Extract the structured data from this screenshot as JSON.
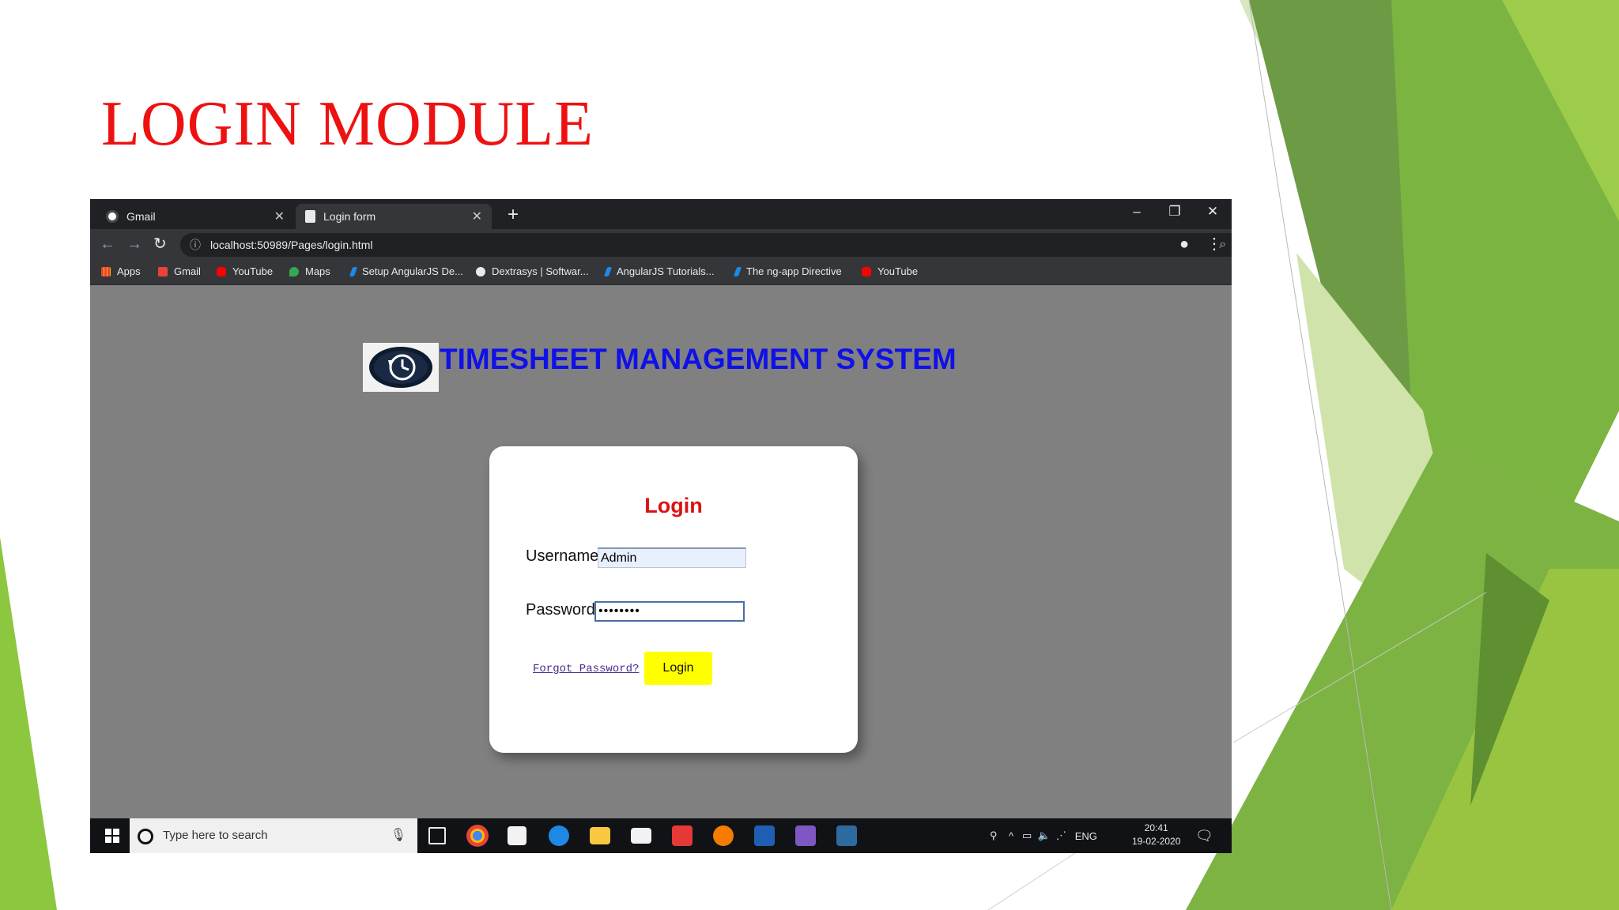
{
  "slide": {
    "title": "LOGIN MODULE"
  },
  "browser": {
    "tabs": [
      {
        "label": "Gmail",
        "icon": "google-icon",
        "active": false
      },
      {
        "label": "Login form",
        "icon": "page-icon",
        "active": true
      }
    ],
    "new_tab": "+",
    "window_controls": {
      "minimize": "–",
      "restore": "❐",
      "close": "✕"
    },
    "url": "localhost:50989/Pages/login.html",
    "bookmarks": [
      {
        "label": "Apps",
        "icon": "apps-grid-icon"
      },
      {
        "label": "Gmail",
        "icon": "gmail-icon"
      },
      {
        "label": "YouTube",
        "icon": "youtube-icon"
      },
      {
        "label": "Maps",
        "icon": "maps-icon"
      },
      {
        "label": "Setup AngularJS De...",
        "icon": "bookmark-icon"
      },
      {
        "label": "Dextrasys | Softwar...",
        "icon": "globe-icon"
      },
      {
        "label": "AngularJS Tutorials...",
        "icon": "bookmark-icon"
      },
      {
        "label": "The ng-app Directive",
        "icon": "bookmark-icon"
      },
      {
        "label": "YouTube",
        "icon": "youtube-icon"
      }
    ]
  },
  "page": {
    "app_title": "TIMESHEET MANAGEMENT SYSTEM",
    "login": {
      "heading": "Login",
      "username_label": "Username",
      "username_value": "Admin",
      "password_label": "Password",
      "password_value": "••••••••",
      "forgot_link": "Forgot Password?",
      "login_button": "Login"
    }
  },
  "taskbar": {
    "search_placeholder": "Type here to search",
    "language": "ENG",
    "time": "20:41",
    "date": "19-02-2020"
  },
  "colors": {
    "title_red": "#ee1111",
    "app_title_blue": "#1010e8",
    "login_button": "#ffff00",
    "slide_green": "#8dc63f"
  }
}
